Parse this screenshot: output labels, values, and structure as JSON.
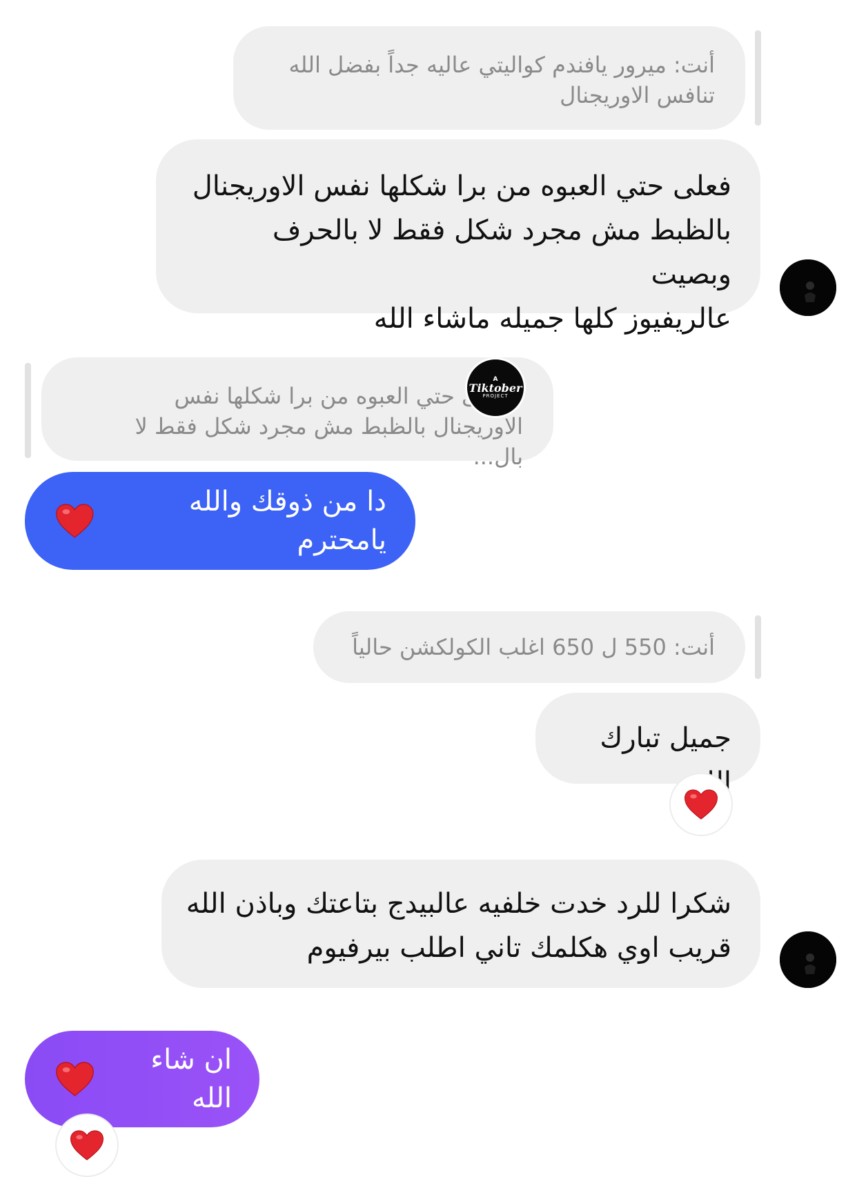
{
  "colors": {
    "incoming_bubble": "#efefef",
    "reply_quote_bg": "#efefef",
    "outgoing_blue": "#3c62f6",
    "outgoing_purple": "#8a4bf5",
    "heart": "#e4252e"
  },
  "messages": [
    {
      "reply_quote": {
        "line1": "أنت: ميرور يافندم كواليتي عاليه جداً بفضل الله",
        "line2": "تنافس الاوريجنال"
      },
      "text_lines": [
        "فعلى حتي العبوه من برا شكلها نفس الاوريجنال",
        "بالظبط مش مجرد شكل فقط لا بالحرف وبصيت",
        "عالريفيوز كلها جميله ماشاء الله"
      ]
    },
    {
      "reply_quote": {
        "line1": ": فعلى حتي العبوه من برا شكلها نفس",
        "line2": "الاوريجنال  بالظبط مش مجرد شكل فقط لا بال..."
      },
      "sticker": {
        "small_text": "A",
        "brand": "Tiktober",
        "sub": "PROJECT"
      },
      "text": "دا من ذوقك والله يامحترم"
    },
    {
      "reply_quote": {
        "line1": "أنت: 550 ل 650 اغلب الكولكشن حالياً"
      },
      "text": "جميل تبارك الله"
    },
    {
      "text_lines": [
        "شكرا للرد خدت خلفيه عالبيدج بتاعتك وباذن الله",
        "قريب اوي هكلمك تاني اطلب بيرفيوم"
      ]
    },
    {
      "text": "ان شاء الله"
    }
  ]
}
